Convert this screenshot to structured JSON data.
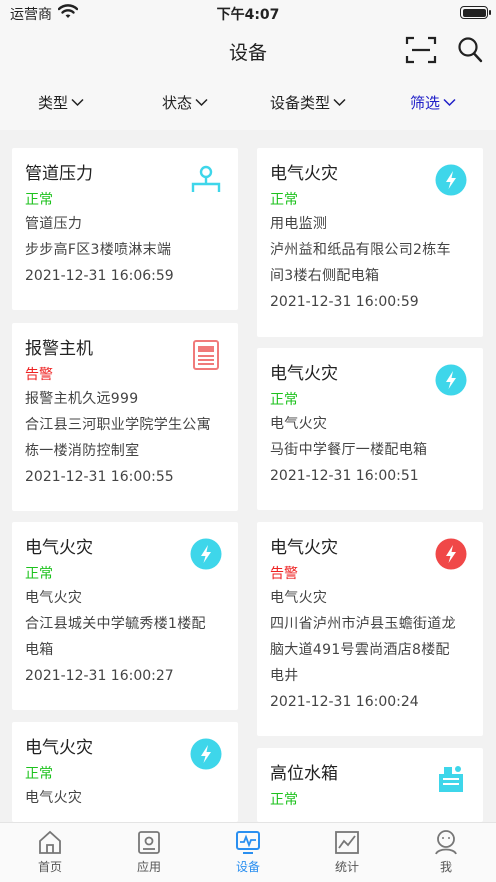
{
  "status_bar": {
    "carrier": "运营商",
    "time": "下午4:07"
  },
  "header": {
    "title": "设备"
  },
  "filters": [
    {
      "label": "类型",
      "active": false
    },
    {
      "label": "状态",
      "active": false
    },
    {
      "label": "设备类型",
      "active": false
    },
    {
      "label": "筛选",
      "active": true
    }
  ],
  "cards": [
    {
      "title": "管道压力",
      "status": "正常",
      "status_type": "ok",
      "lines": [
        "管道压力",
        "步步高F区3楼喷淋末端"
      ],
      "date": "2021-12-31 16:06:59",
      "icon": "pressure-gauge-icon"
    },
    {
      "title": "电气火灾",
      "status": "正常",
      "status_type": "ok",
      "lines": [
        "用电监测",
        "泸州益和纸品有限公司2栋车",
        "间3楼右侧配电箱"
      ],
      "date": "2021-12-31 16:00:59",
      "icon": "lightning-icon"
    },
    {
      "title": "报警主机",
      "status": "告警",
      "status_type": "alarm",
      "lines": [
        "报警主机久远999",
        "合江县三河职业学院学生公寓",
        "栋一楼消防控制室"
      ],
      "date": "2021-12-31 16:00:55",
      "icon": "alarm-host-icon"
    },
    {
      "title": "电气火灾",
      "status": "正常",
      "status_type": "ok",
      "lines": [
        "电气火灾",
        "马街中学餐厅一楼配电箱"
      ],
      "date": "2021-12-31 16:00:51",
      "icon": "lightning-icon"
    },
    {
      "title": "电气火灾",
      "status": "正常",
      "status_type": "ok",
      "lines": [
        "电气火灾",
        "合江县城关中学毓秀楼1楼配",
        "电箱"
      ],
      "date": "2021-12-31 16:00:27",
      "icon": "lightning-icon"
    },
    {
      "title": "电气火灾",
      "status": "告警",
      "status_type": "alarm",
      "lines": [
        "电气火灾",
        "四川省泸州市泸县玉蟾街道龙",
        "脑大道491号雲尚酒店8楼配",
        "电井"
      ],
      "date": "2021-12-31 16:00:24",
      "icon": "lightning-icon"
    },
    {
      "title": "电气火灾",
      "status": "正常",
      "status_type": "ok",
      "lines": [
        "电气火灾"
      ],
      "date": "",
      "icon": "lightning-icon"
    },
    {
      "title": "高位水箱",
      "status": "正常",
      "status_type": "ok",
      "lines": [],
      "date": "",
      "icon": "water-tank-icon"
    }
  ],
  "tabs": [
    {
      "label": "首页",
      "icon": "home-icon",
      "active": false
    },
    {
      "label": "应用",
      "icon": "apps-icon",
      "active": false
    },
    {
      "label": "设备",
      "icon": "device-icon",
      "active": true
    },
    {
      "label": "统计",
      "icon": "chart-icon",
      "active": false
    },
    {
      "label": "我",
      "icon": "profile-icon",
      "active": false
    }
  ],
  "colors": {
    "ok": "#1dc21d",
    "alarm": "#ee2222",
    "accent": "#2020c8",
    "tab_active": "#2a8ff0",
    "icon_cyan": "#3ed6ea"
  }
}
